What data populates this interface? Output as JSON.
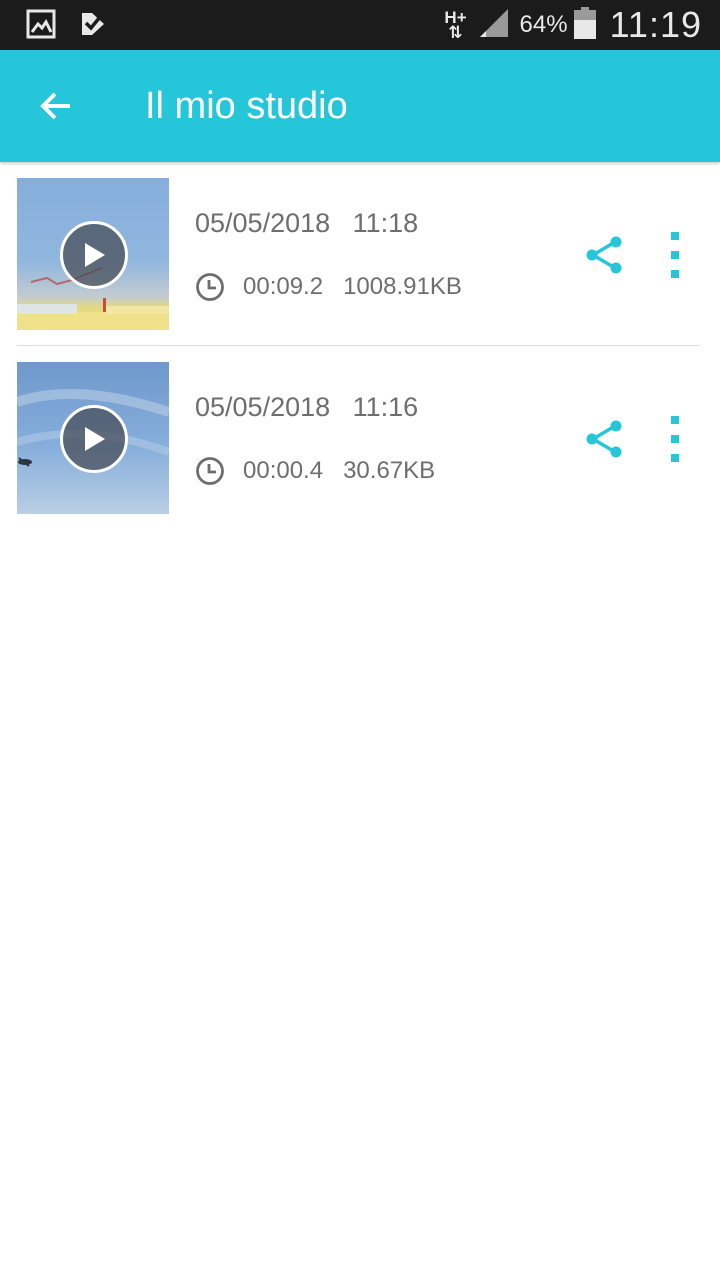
{
  "status_bar": {
    "network": "H+",
    "battery_percent": "64%",
    "time": "11:19",
    "left_icons": [
      "gallery-notification-icon",
      "task-check-notification-icon"
    ]
  },
  "app_bar": {
    "title": "Il mio studio",
    "back_icon": "arrow-left-icon",
    "background": "#26c6da"
  },
  "recordings": [
    {
      "date": "05/05/2018   11:18",
      "duration": "00:09.2",
      "size": "1008.91KB"
    },
    {
      "date": "05/05/2018   11:16",
      "duration": "00:00.4",
      "size": "30.67KB"
    }
  ],
  "colors": {
    "accent": "#26c6da",
    "text_secondary": "#6e6e6e"
  }
}
